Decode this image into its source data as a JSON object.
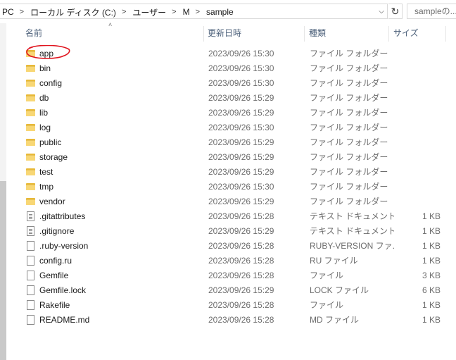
{
  "address": {
    "crumbs": [
      "PC",
      "ローカル ディスク (C:)",
      "ユーザー",
      "M",
      "sample"
    ],
    "search_placeholder": "sampleの..."
  },
  "columns": {
    "name": "名前",
    "date": "更新日時",
    "type": "種類",
    "size": "サイズ"
  },
  "icons": {
    "folder": "folder-icon",
    "file": "file-icon",
    "refresh": "refresh-icon",
    "dropdown": "chevron-down-icon"
  },
  "annotation_color": "#e0141e",
  "files": [
    {
      "name": "app",
      "date": "2023/09/26 15:30",
      "type": "ファイル フォルダー",
      "size": "",
      "kind": "folder"
    },
    {
      "name": "bin",
      "date": "2023/09/26 15:30",
      "type": "ファイル フォルダー",
      "size": "",
      "kind": "folder"
    },
    {
      "name": "config",
      "date": "2023/09/26 15:30",
      "type": "ファイル フォルダー",
      "size": "",
      "kind": "folder"
    },
    {
      "name": "db",
      "date": "2023/09/26 15:29",
      "type": "ファイル フォルダー",
      "size": "",
      "kind": "folder"
    },
    {
      "name": "lib",
      "date": "2023/09/26 15:29",
      "type": "ファイル フォルダー",
      "size": "",
      "kind": "folder"
    },
    {
      "name": "log",
      "date": "2023/09/26 15:30",
      "type": "ファイル フォルダー",
      "size": "",
      "kind": "folder"
    },
    {
      "name": "public",
      "date": "2023/09/26 15:29",
      "type": "ファイル フォルダー",
      "size": "",
      "kind": "folder"
    },
    {
      "name": "storage",
      "date": "2023/09/26 15:29",
      "type": "ファイル フォルダー",
      "size": "",
      "kind": "folder"
    },
    {
      "name": "test",
      "date": "2023/09/26 15:29",
      "type": "ファイル フォルダー",
      "size": "",
      "kind": "folder"
    },
    {
      "name": "tmp",
      "date": "2023/09/26 15:30",
      "type": "ファイル フォルダー",
      "size": "",
      "kind": "folder"
    },
    {
      "name": "vendor",
      "date": "2023/09/26 15:29",
      "type": "ファイル フォルダー",
      "size": "",
      "kind": "folder"
    },
    {
      "name": ".gitattributes",
      "date": "2023/09/26 15:28",
      "type": "テキスト ドキュメント",
      "size": "1 KB",
      "kind": "text"
    },
    {
      "name": ".gitignore",
      "date": "2023/09/26 15:29",
      "type": "テキスト ドキュメント",
      "size": "1 KB",
      "kind": "text"
    },
    {
      "name": ".ruby-version",
      "date": "2023/09/26 15:28",
      "type": "RUBY-VERSION ファ...",
      "size": "1 KB",
      "kind": "file"
    },
    {
      "name": "config.ru",
      "date": "2023/09/26 15:28",
      "type": "RU ファイル",
      "size": "1 KB",
      "kind": "file"
    },
    {
      "name": "Gemfile",
      "date": "2023/09/26 15:28",
      "type": "ファイル",
      "size": "3 KB",
      "kind": "file"
    },
    {
      "name": "Gemfile.lock",
      "date": "2023/09/26 15:29",
      "type": "LOCK ファイル",
      "size": "6 KB",
      "kind": "file"
    },
    {
      "name": "Rakefile",
      "date": "2023/09/26 15:28",
      "type": "ファイル",
      "size": "1 KB",
      "kind": "file"
    },
    {
      "name": "README.md",
      "date": "2023/09/26 15:28",
      "type": "MD ファイル",
      "size": "1 KB",
      "kind": "file"
    }
  ]
}
